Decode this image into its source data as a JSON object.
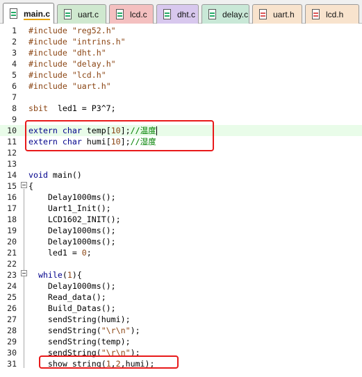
{
  "tabs": [
    {
      "label": "main.c",
      "active": true,
      "kind": "c"
    },
    {
      "label": "uart.c",
      "active": false,
      "kind": "c"
    },
    {
      "label": "lcd.c",
      "active": false,
      "kind": "c"
    },
    {
      "label": "dht.c",
      "active": false,
      "kind": "c"
    },
    {
      "label": "delay.c",
      "active": false,
      "kind": "c"
    },
    {
      "label": "uart.h",
      "active": false,
      "kind": "h"
    },
    {
      "label": "lcd.h",
      "active": false,
      "kind": "h"
    }
  ],
  "tab_colors": [
    "#ffffff",
    "#cfe8cf",
    "#f4c0c0",
    "#d8c8ee",
    "#c9e8d7",
    "#f8e3cd",
    "#f8e3cd"
  ],
  "current_line": 10,
  "lines": [
    {
      "n": "1",
      "code": [
        [
          "kw-pre",
          "#include "
        ],
        [
          "str",
          "\"reg52.h\""
        ]
      ]
    },
    {
      "n": "2",
      "code": [
        [
          "kw-pre",
          "#include "
        ],
        [
          "str",
          "\"intrins.h\""
        ]
      ]
    },
    {
      "n": "3",
      "code": [
        [
          "kw-pre",
          "#include "
        ],
        [
          "str",
          "\"dht.h\""
        ]
      ]
    },
    {
      "n": "4",
      "code": [
        [
          "kw-pre",
          "#include "
        ],
        [
          "str",
          "\"delay.h\""
        ]
      ]
    },
    {
      "n": "5",
      "code": [
        [
          "kw-pre",
          "#include "
        ],
        [
          "str",
          "\"lcd.h\""
        ]
      ]
    },
    {
      "n": "6",
      "code": [
        [
          "kw-pre",
          "#include "
        ],
        [
          "str",
          "\"uart.h\""
        ]
      ]
    },
    {
      "n": "7",
      "code": []
    },
    {
      "n": "8",
      "code": [
        [
          "kw-pre",
          "sbit"
        ],
        [
          "",
          "  led1 = P3^7;"
        ]
      ]
    },
    {
      "n": "9",
      "code": []
    },
    {
      "n": "10",
      "code": [
        [
          "kw",
          "extern"
        ],
        [
          "",
          " "
        ],
        [
          "kw",
          "char"
        ],
        [
          "",
          " temp["
        ],
        [
          "num",
          "10"
        ],
        [
          "",
          "];"
        ],
        [
          "cmt",
          "//温度"
        ]
      ],
      "caret": true
    },
    {
      "n": "11",
      "code": [
        [
          "kw",
          "extern"
        ],
        [
          "",
          " "
        ],
        [
          "kw",
          "char"
        ],
        [
          "",
          " humi["
        ],
        [
          "num",
          "10"
        ],
        [
          "",
          "];"
        ],
        [
          "cmt",
          "//湿度"
        ]
      ]
    },
    {
      "n": "12",
      "code": []
    },
    {
      "n": "13",
      "code": []
    },
    {
      "n": "14",
      "code": [
        [
          "kw",
          "void"
        ],
        [
          "",
          " main()"
        ]
      ]
    },
    {
      "n": "15",
      "code": [
        [
          "",
          "{"
        ]
      ]
    },
    {
      "n": "16",
      "code": [
        [
          "",
          "    Delay1000ms();"
        ]
      ]
    },
    {
      "n": "17",
      "code": [
        [
          "",
          "    Uart1_Init();"
        ]
      ]
    },
    {
      "n": "18",
      "code": [
        [
          "",
          "    LCD1602_INIT();"
        ]
      ]
    },
    {
      "n": "19",
      "code": [
        [
          "",
          "    Delay1000ms();"
        ]
      ]
    },
    {
      "n": "20",
      "code": [
        [
          "",
          "    Delay1000ms();"
        ]
      ]
    },
    {
      "n": "21",
      "code": [
        [
          "",
          "    led1 = "
        ],
        [
          "num",
          "0"
        ],
        [
          "",
          ";"
        ]
      ]
    },
    {
      "n": "22",
      "code": []
    },
    {
      "n": "23",
      "code": [
        [
          "",
          "  "
        ],
        [
          "kw",
          "while"
        ],
        [
          "",
          "("
        ],
        [
          "num",
          "1"
        ],
        [
          "",
          "){"
        ]
      ]
    },
    {
      "n": "24",
      "code": [
        [
          "",
          "    Delay1000ms();"
        ]
      ]
    },
    {
      "n": "25",
      "code": [
        [
          "",
          "    Read_data();"
        ]
      ]
    },
    {
      "n": "26",
      "code": [
        [
          "",
          "    Build_Datas();"
        ]
      ]
    },
    {
      "n": "27",
      "code": [
        [
          "",
          "    sendString(humi);"
        ]
      ]
    },
    {
      "n": "28",
      "code": [
        [
          "",
          "    sendString("
        ],
        [
          "str",
          "\"\\r\\n\""
        ],
        [
          "",
          ");"
        ]
      ]
    },
    {
      "n": "29",
      "code": [
        [
          "",
          "    sendString(temp);"
        ]
      ]
    },
    {
      "n": "30",
      "code": [
        [
          "",
          "    sendString("
        ],
        [
          "str",
          "\"\\r\\n\""
        ],
        [
          "",
          ");"
        ]
      ]
    },
    {
      "n": "31",
      "code": [
        [
          "",
          "    show_string("
        ],
        [
          "num",
          "1"
        ],
        [
          "",
          ","
        ],
        [
          "num",
          "2"
        ],
        [
          "",
          ",humi);"
        ]
      ]
    }
  ]
}
